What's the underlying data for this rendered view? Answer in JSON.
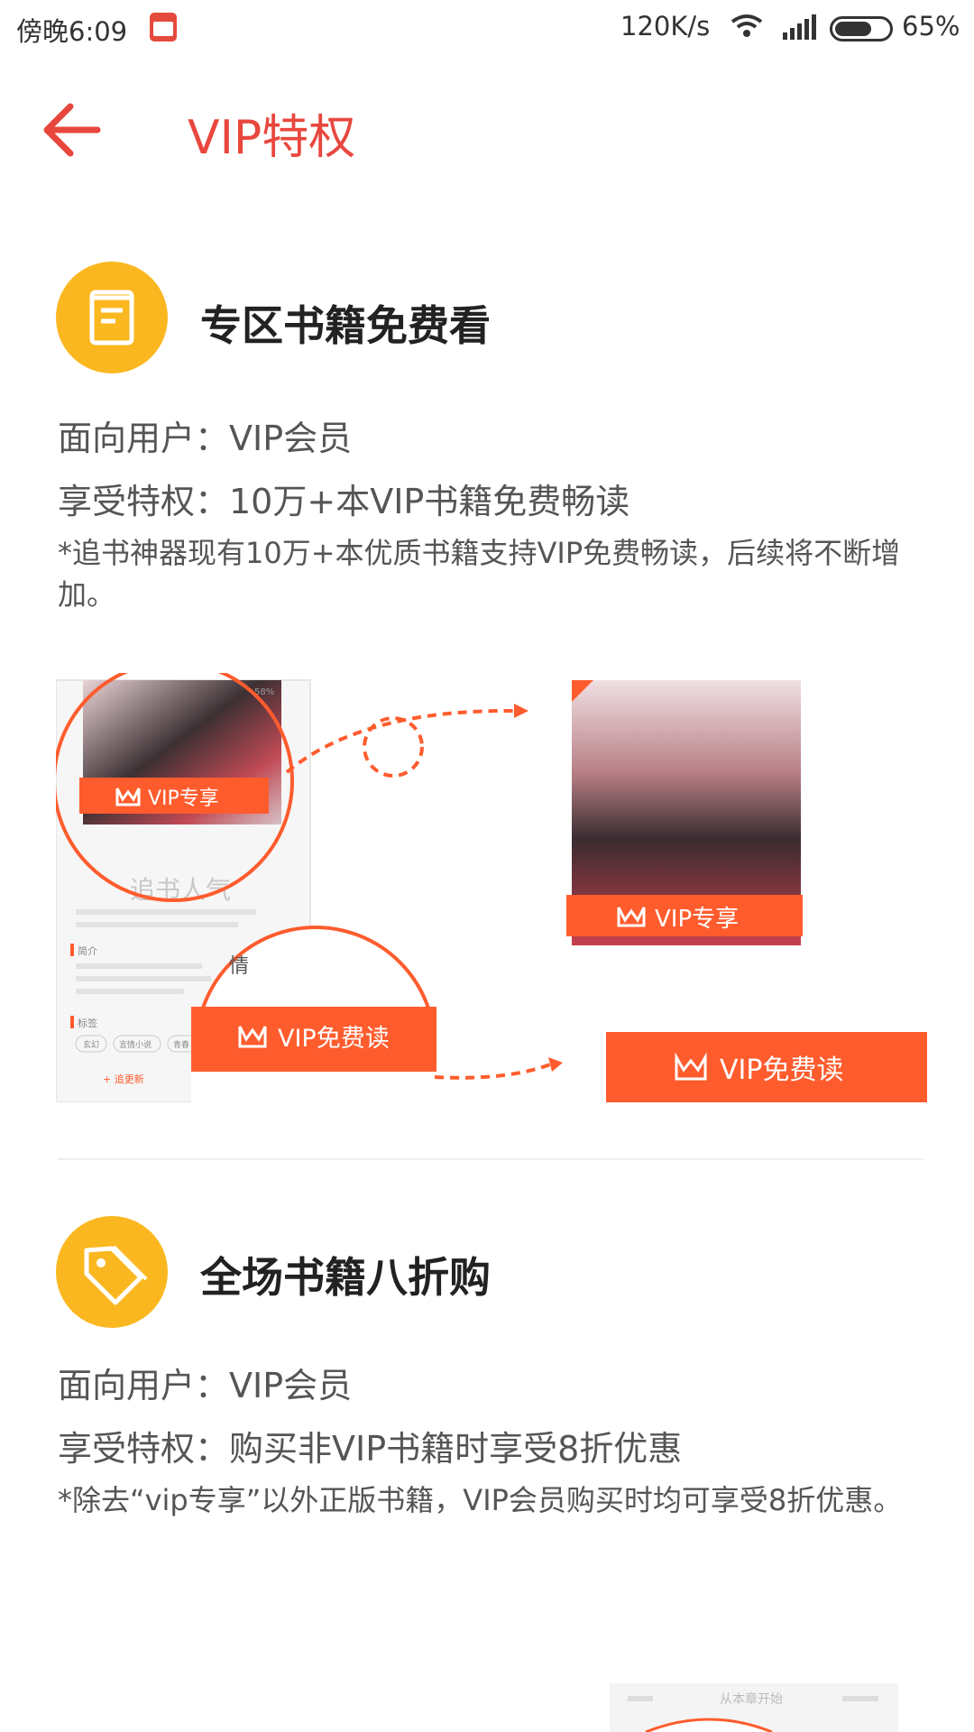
{
  "status_bar": {
    "time": "傍晚6:09",
    "net_speed": "120K/s",
    "battery": "65%",
    "battery_level": 0.65
  },
  "header": {
    "title": "VIP特权",
    "back_icon": "arrow-left-icon",
    "accent": "#e8473d"
  },
  "sections": [
    {
      "icon": "book-icon",
      "title": "专区书籍免费看",
      "audience": "面向用户：VIP会员",
      "privilege": "享受特权：10万+本VIP书籍免费畅读",
      "note": "*追书神器现有10万+本优质书籍支持VIP免费畅读，后续将不断增加。",
      "illustration": {
        "badge_small": "VIP专享",
        "badge_large": "VIP专享",
        "watermark": "追书人气",
        "tag_section": "简介",
        "tag_label": "标签",
        "tag_chips": [
          "玄幻",
          "言情小说",
          "青春"
        ],
        "follow_update": "+ 追更新",
        "detail_tag": "情",
        "read_button_small": "VIP免费读",
        "read_button_large": "VIP免费读"
      }
    },
    {
      "icon": "tag-icon",
      "title": "全场书籍八折购",
      "audience": "面向用户：VIP会员",
      "privilege": "享受特权：购买非VIP书籍时享受8折优惠",
      "note": "*除去“vip专享”以外正版书籍，VIP会员购买时均可享受8折优惠。"
    }
  ],
  "footer_preview": {
    "caption": "从本章开始"
  },
  "colors": {
    "icon_bg": "#fbb720",
    "vip_orange": "#ff5c2e",
    "text_main": "#222222",
    "text_body": "#555555"
  }
}
